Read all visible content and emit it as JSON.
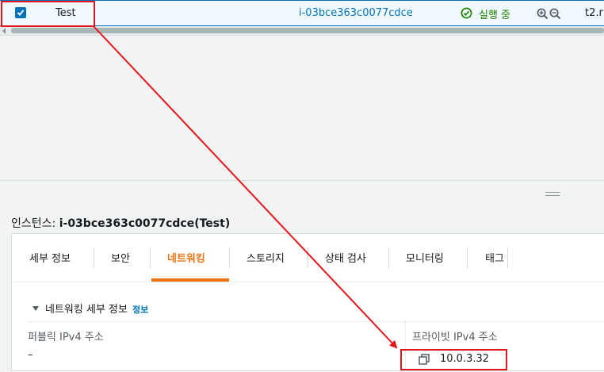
{
  "instance_row": {
    "checkbox_checked": true,
    "name": "Test",
    "instance_id": "i-03bce363c0077cdce",
    "status_text": "실행 중",
    "status_color": "#1d8102",
    "status_icon": "check-circle-icon",
    "zoom_in_icon": "zoom-in-icon",
    "zoom_out_icon": "zoom-out-icon",
    "instance_type_partial": "t2.r"
  },
  "details_panel": {
    "title_label": "인스턴스:",
    "title_id": "i-03bce363c0077cdce(Test)",
    "tabs": [
      {
        "label": "세부 정보",
        "active": false
      },
      {
        "label": "보안",
        "active": false
      },
      {
        "label": "네트워킹",
        "active": true
      },
      {
        "label": "스토리지",
        "active": false
      },
      {
        "label": "상태 검사",
        "active": false
      },
      {
        "label": "모니터링",
        "active": false
      },
      {
        "label": "태그",
        "active": false
      }
    ],
    "accent_color": "#ec7211",
    "section": {
      "title": "네트워킹 세부 정보",
      "info_link": "정보",
      "public_ipv4_label": "퍼블릭 IPv4 주소",
      "public_ipv4_value": "–",
      "private_ipv4_label": "프라이빗 IPv4 주소",
      "private_ipv4_value": "10.0.3.32"
    }
  },
  "annotation_color": "#e3161b"
}
